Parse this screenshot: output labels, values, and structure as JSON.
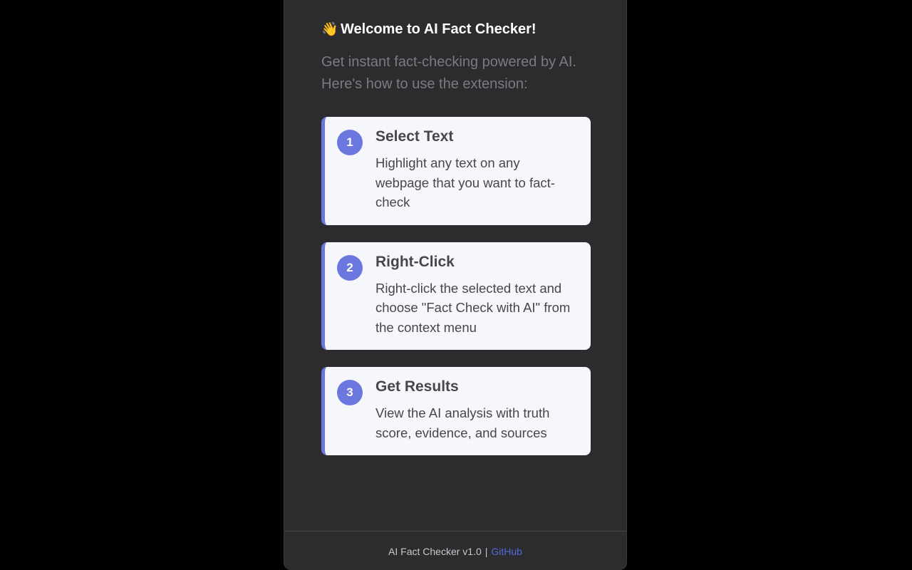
{
  "header": {
    "icon": "waving-hand-icon",
    "icon_glyph": "👋",
    "title": "Welcome to AI Fact Checker!",
    "subtitle": "Get instant fact-checking powered by AI. Here's how to use the extension:"
  },
  "steps": [
    {
      "number": "1",
      "title": "Select Text",
      "description": "Highlight any text on any webpage that you want to fact-check"
    },
    {
      "number": "2",
      "title": "Right-Click",
      "description": "Right-click the selected text and choose \"Fact Check with AI\" from the context menu"
    },
    {
      "number": "3",
      "title": "Get Results",
      "description": "View the AI analysis with truth score, evidence, and sources"
    }
  ],
  "footer": {
    "version_text": "AI Fact Checker v1.0",
    "separator": "|",
    "link_label": "GitHub"
  },
  "colors": {
    "accent": "#6b76df",
    "panel_background": "#2c2c2e",
    "card_background": "#f6f7fa",
    "link": "#4f6bd6"
  }
}
